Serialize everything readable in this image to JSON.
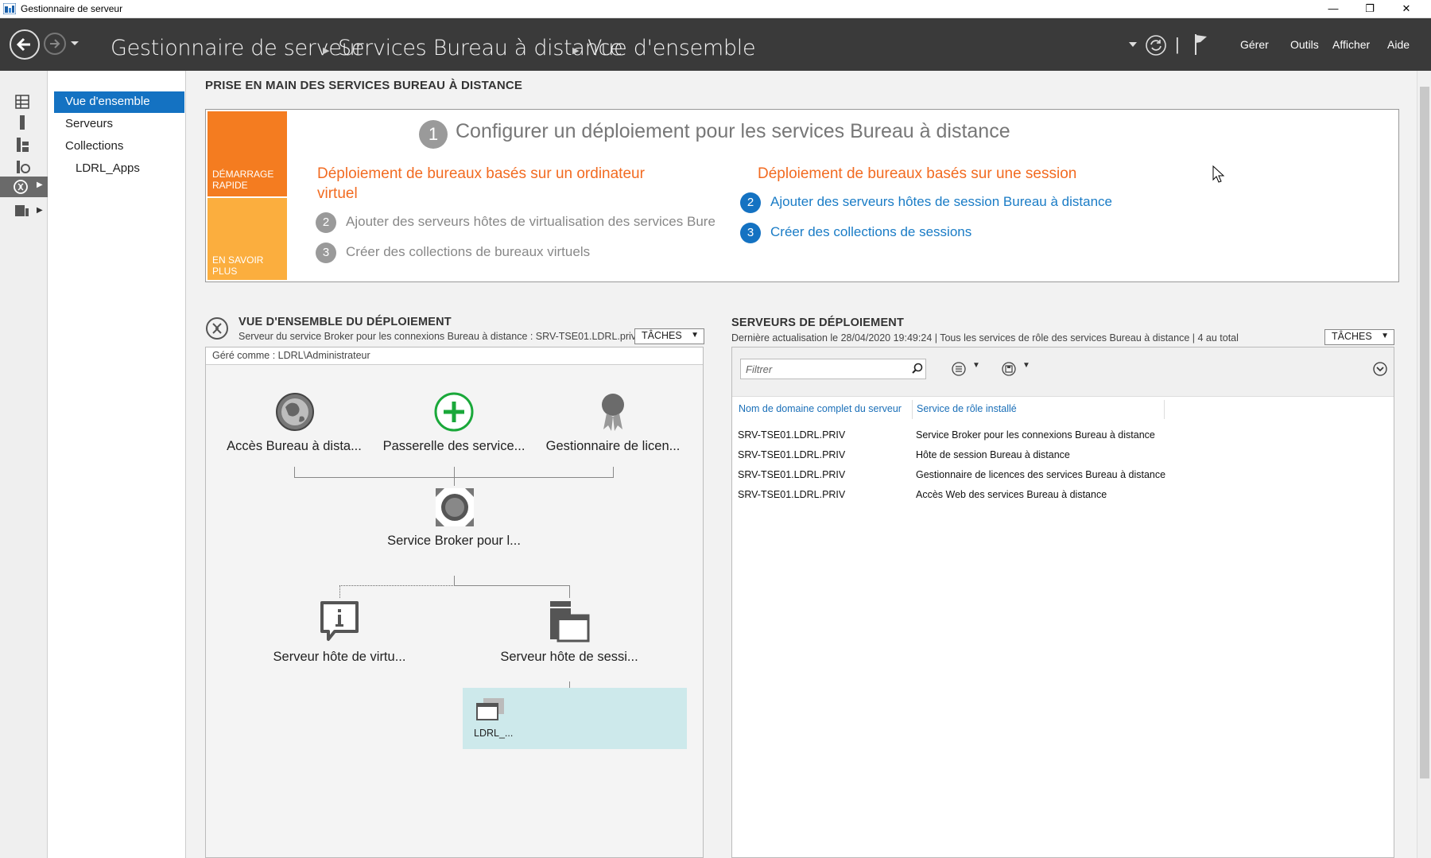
{
  "window": {
    "title": "Gestionnaire de serveur",
    "minimize": "—",
    "restore": "❐",
    "close": "✕"
  },
  "header": {
    "breadcrumb": [
      "Gestionnaire de serveur",
      "Services Bureau à distance",
      "Vue d'ensemble"
    ],
    "menu": [
      "Gérer",
      "Outils",
      "Afficher",
      "Aide"
    ],
    "sep": "|"
  },
  "nav": {
    "items": [
      {
        "label": "Vue d'ensemble",
        "selected": true
      },
      {
        "label": "Serveurs"
      },
      {
        "label": "Collections"
      },
      {
        "label": "LDRL_Apps"
      }
    ]
  },
  "rail_icons": [
    "dashboard-icon",
    "local-server-icon",
    "all-servers-icon",
    "file-storage-icon",
    "remote-desktop-icon",
    "iis-icon"
  ],
  "quickstart": {
    "section_title": "PRISE EN MAIN DES SERVICES BUREAU À DISTANCE",
    "tile1": [
      "DÉMARRAGE",
      "RAPIDE"
    ],
    "tile2": [
      "EN SAVOIR",
      "PLUS"
    ],
    "step1_num": "1",
    "step1_title": "Configurer un déploiement pour les services Bureau à distance",
    "left_heading_line1": "Déploiement de bureaux basés sur un ordinateur",
    "left_heading_line2": "virtuel",
    "left_steps": [
      {
        "num": "2",
        "text": "Ajouter des serveurs hôtes de virtualisation des services Bureau à distance"
      },
      {
        "num": "3",
        "text": "Créer des collections de bureaux virtuels"
      }
    ],
    "right_heading": "Déploiement de bureaux basés sur une session",
    "right_steps": [
      {
        "num": "2",
        "text": "Ajouter des serveurs hôtes de session Bureau à distance"
      },
      {
        "num": "3",
        "text": "Créer des collections de sessions"
      }
    ]
  },
  "deployment_overview": {
    "title": "VUE D'ENSEMBLE DU DÉPLOIEMENT",
    "subtitle": "Serveur du service Broker pour les connexions Bureau à distance : SRV-TSE01.LDRL.priv",
    "tasks": "TÂCHES",
    "managed_as": "Géré comme : LDRL\\Administrateur",
    "nodes": {
      "web_access": "Accès Bureau à dista...",
      "gateway": "Passerelle des service...",
      "licensing": "Gestionnaire de licen...",
      "broker": "Service Broker pour l...",
      "virt_host": "Serveur hôte de virtu...",
      "session_host": "Serveur hôte de sessi...",
      "collection": "LDRL_..."
    }
  },
  "deployment_servers": {
    "title": "SERVEURS DE DÉPLOIEMENT",
    "subtitle": "Dernière actualisation le 28/04/2020 19:49:24 | Tous les services de rôle des services Bureau à distance  | 4 au total",
    "tasks": "TÂCHES",
    "filter_placeholder": "Filtrer",
    "columns": [
      "Nom de domaine complet du serveur",
      "Service de rôle installé"
    ],
    "rows": [
      [
        "SRV-TSE01.LDRL.PRIV",
        "Service Broker pour les connexions Bureau à distance"
      ],
      [
        "SRV-TSE01.LDRL.PRIV",
        "Hôte de session Bureau à distance"
      ],
      [
        "SRV-TSE01.LDRL.PRIV",
        "Gestionnaire de licences des services Bureau à distance"
      ],
      [
        "SRV-TSE01.LDRL.PRIV",
        "Accès Web des services Bureau à distance"
      ]
    ]
  },
  "colors": {
    "header": "#3a3a3a",
    "accent": "#1472c2",
    "orange": "#f26b21",
    "tile_orange": "#f47c20",
    "tile_yellow": "#fbae3e",
    "collection_bg": "#cde9eb"
  }
}
